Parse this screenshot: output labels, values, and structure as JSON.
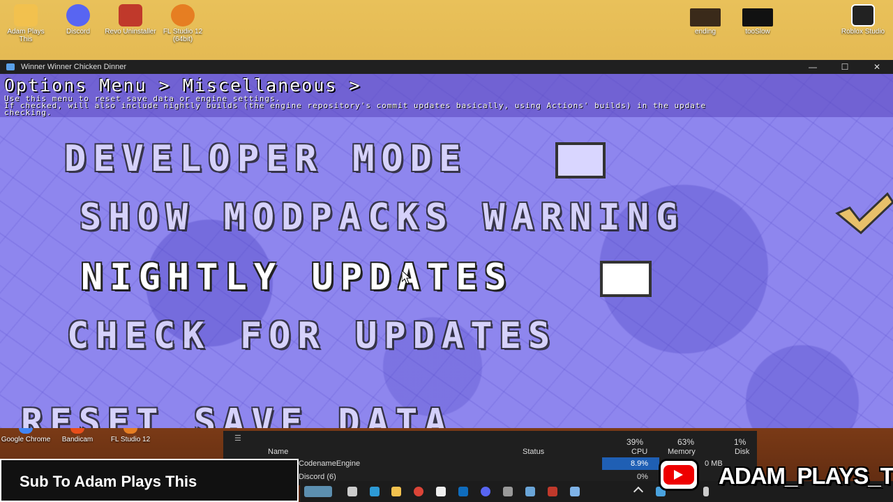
{
  "desktop": {
    "icons": [
      {
        "label": "Adam Plays This",
        "icon": "folder-icon",
        "color": "#f2c14e"
      },
      {
        "label": "Discord",
        "icon": "discord-icon",
        "color": "#5865f2"
      },
      {
        "label": "Revo Uninstaller",
        "icon": "revo-uninstaller-icon",
        "color": "#c0392b"
      },
      {
        "label": "FL Studio 12 (64bit)",
        "icon": "fl-studio-icon",
        "color": "#e67e22"
      },
      {
        "label": "ending",
        "icon": "video-file-icon",
        "color": "#3a2a1a"
      },
      {
        "label": "tooSlow",
        "icon": "video-file-icon",
        "color": "#111111"
      },
      {
        "label": "Roblox Studio",
        "icon": "roblox-studio-icon",
        "color": "#222222"
      }
    ]
  },
  "window": {
    "title": "Winner Winner Chicken Dinner",
    "minimize": "—",
    "maximize": "☐",
    "close": "✕"
  },
  "game": {
    "breadcrumb": "Options Menu > Miscellaneous >",
    "description_lines": [
      "Use this menu to reset save data or engine settings.",
      "If checked, will also include nightly builds (the engine repository's commit updates basically, using Actions' builds) in the update",
      "checking."
    ],
    "options": [
      {
        "label": "DEVELOPER MODE",
        "checkbox": true,
        "checked": false
      },
      {
        "label": "SHOW MODPACKS WARNING",
        "checkbox": true,
        "checked": true
      },
      {
        "label": "NIGHTLY UPDATES",
        "checkbox": true,
        "checked": false,
        "selected": true
      },
      {
        "label": "CHECK FOR UPDATES",
        "checkbox": false
      },
      {
        "label": "RESET SAVE DATA",
        "checkbox": false
      }
    ]
  },
  "desktop_bottom_icons": [
    {
      "label": "Google Chrome",
      "icon": "chrome-icon"
    },
    {
      "label": "Bandicam",
      "icon": "bandicam-icon"
    },
    {
      "label": "FL Studio 12",
      "icon": "fl-studio-icon"
    }
  ],
  "task_manager": {
    "headers": {
      "name": "Name",
      "status": "Status",
      "cpu": "CPU",
      "memory": "Memory",
      "disk": "Disk"
    },
    "totals": {
      "cpu": "39%",
      "memory": "63%",
      "disk": "1%"
    },
    "rows": [
      {
        "name": "CodenameEngine",
        "cpu": "8.9%",
        "disk": "0 MB"
      },
      {
        "name": "Discord (6)",
        "cpu": "0%"
      }
    ]
  },
  "overlay": {
    "subscribe_text": "Sub To Adam Plays This",
    "channel_name": "ADAM_PLAYS_THIS"
  }
}
